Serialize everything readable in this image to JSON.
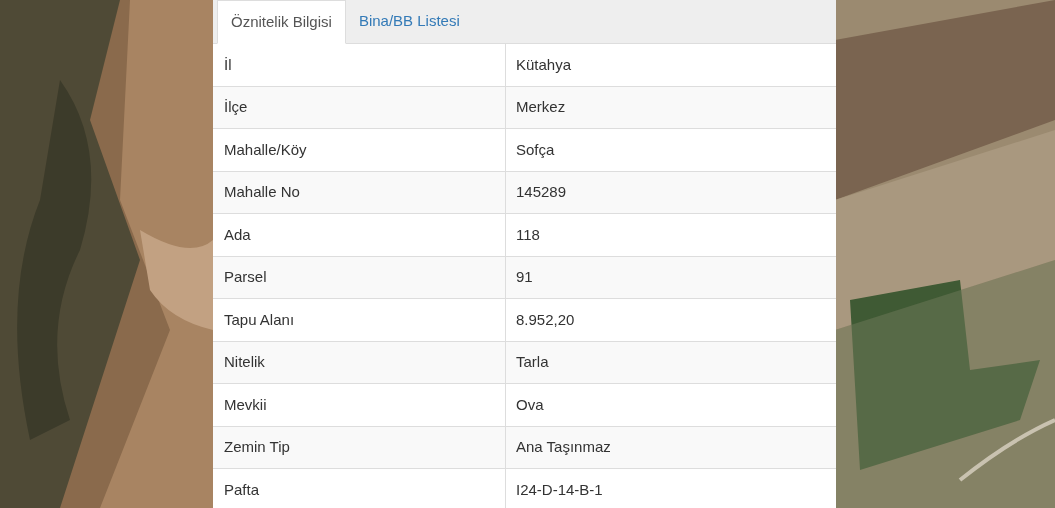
{
  "tabs": [
    {
      "label": "Öznitelik Bilgisi",
      "selected": true
    },
    {
      "label": "Bina/BB Listesi",
      "selected": false
    }
  ],
  "attributes": [
    {
      "name": "İl",
      "value": "Kütahya"
    },
    {
      "name": "İlçe",
      "value": "Merkez"
    },
    {
      "name": "Mahalle/Köy",
      "value": "Sofça"
    },
    {
      "name": "Mahalle No",
      "value": "145289"
    },
    {
      "name": "Ada",
      "value": "118"
    },
    {
      "name": "Parsel",
      "value": "91"
    },
    {
      "name": "Tapu Alanı",
      "value": "8.952,20"
    },
    {
      "name": "Nitelik",
      "value": "Tarla"
    },
    {
      "name": "Mevkii",
      "value": "Ova"
    },
    {
      "name": "Zemin Tip",
      "value": "Ana Taşınmaz"
    },
    {
      "name": "Pafta",
      "value": "I24-D-14-B-1"
    }
  ]
}
